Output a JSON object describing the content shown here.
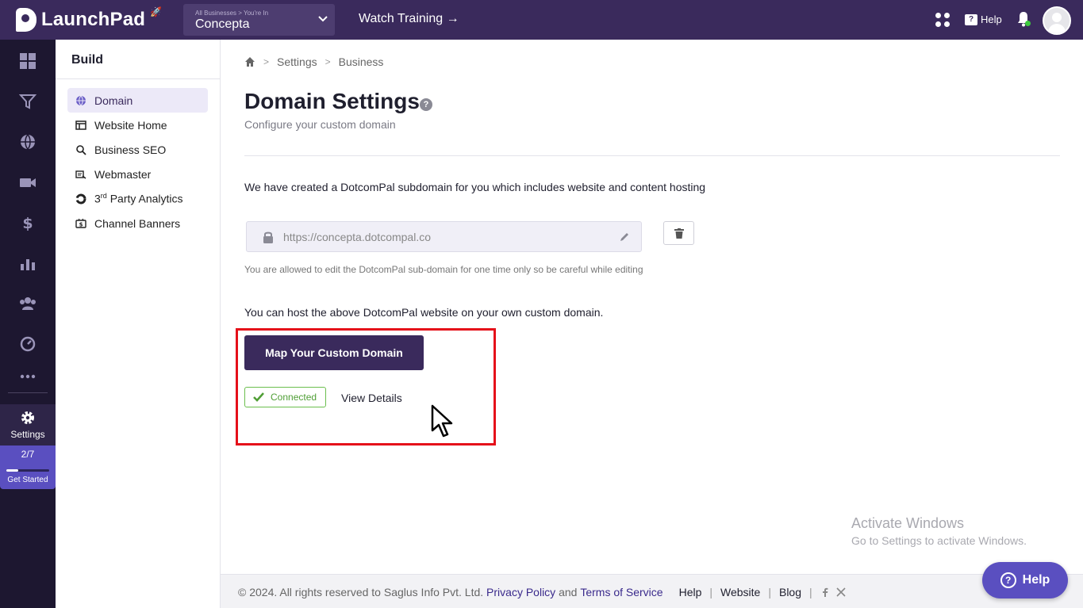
{
  "topbar": {
    "logo_text": "LaunchPad",
    "business_select": {
      "sub_label": "All Businesses  >  You're In",
      "value": "Concepta"
    },
    "watch_training": "Watch Training →",
    "help_label": "Help"
  },
  "rail": {
    "settings_label": "Settings",
    "get_started": {
      "count": "2/7",
      "label": "Get Started",
      "progress": 0.2857
    }
  },
  "sidebar": {
    "title": "Build",
    "items": [
      {
        "label": "Domain",
        "icon": "globe-icon",
        "active": true
      },
      {
        "label": "Website Home",
        "icon": "browser-icon",
        "active": false
      },
      {
        "label": "Business SEO",
        "icon": "search-icon",
        "active": false
      },
      {
        "label": "Webmaster",
        "icon": "webmaster-icon",
        "active": false
      },
      {
        "label_prefix": "3",
        "label_sup": "rd",
        "label_rest": " Party Analytics",
        "icon": "analytics-icon",
        "active": false
      },
      {
        "label": "Channel Banners",
        "icon": "banner-icon",
        "active": false
      }
    ]
  },
  "breadcrumb": {
    "items": [
      "Settings",
      "Business"
    ]
  },
  "page": {
    "title": "Domain Settings",
    "subtitle": "Configure your custom domain",
    "intro": "We have created a DotcomPal subdomain for you which includes website and content hosting",
    "subdomain": "https://concepta.dotcompal.co",
    "note": "You are allowed to edit the DotcomPal sub-domain for one time only so be careful while editing",
    "host_text": "You can host the above DotcomPal website on your own custom domain.",
    "map_button": "Map Your Custom Domain",
    "status": "Connected",
    "view_details": "View Details"
  },
  "watermark": {
    "title": "Activate Windows",
    "subtitle": "Go to Settings to activate Windows."
  },
  "footer": {
    "copyright": "©  2024. All rights reserved to Saglus Info Pvt. Ltd.",
    "privacy": "Privacy Policy",
    "and": "and",
    "terms": "Terms of Service",
    "links": [
      "Help",
      "Website",
      "Blog"
    ]
  },
  "help_fab": "Help",
  "colors": {
    "brand": "#3a2a5c",
    "accent": "#5a4fc0",
    "success": "#4f9e35",
    "highlight": "#e5101a"
  }
}
